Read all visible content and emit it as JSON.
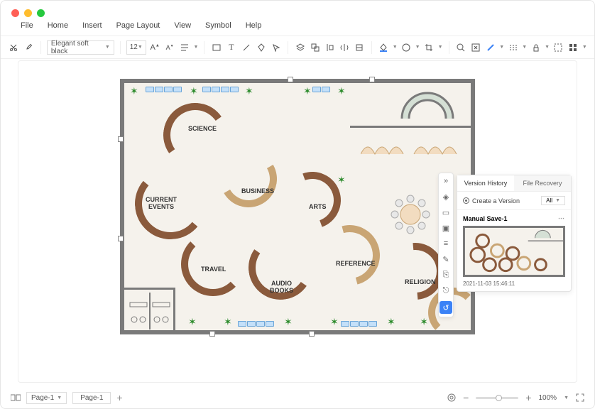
{
  "menu": {
    "file": "File",
    "home": "Home",
    "insert": "Insert",
    "pagelayout": "Page Layout",
    "view": "View",
    "symbol": "Symbol",
    "help": "Help"
  },
  "toolbar": {
    "font_name": "Elegant soft black",
    "font_size": "12"
  },
  "floor": {
    "sections": {
      "science": "SCIENCE",
      "currentevents": "CURRENT\nEVENTS",
      "business": "BUSINESS",
      "arts": "ARTS",
      "travel": "TRAVEL",
      "audiobooks": "AUDIO\nBOOKS",
      "reference": "REFERENCE",
      "religion": "RELIGION"
    }
  },
  "version_panel": {
    "tab_history": "Version History",
    "tab_recovery": "File Recovery",
    "create": "Create a Version",
    "filter": "All",
    "entry_title": "Manual Save-1",
    "entry_date": "2021-11-03 15:46:11"
  },
  "status": {
    "page_dd": "Page-1",
    "page_tab": "Page-1",
    "zoom": "100%"
  }
}
